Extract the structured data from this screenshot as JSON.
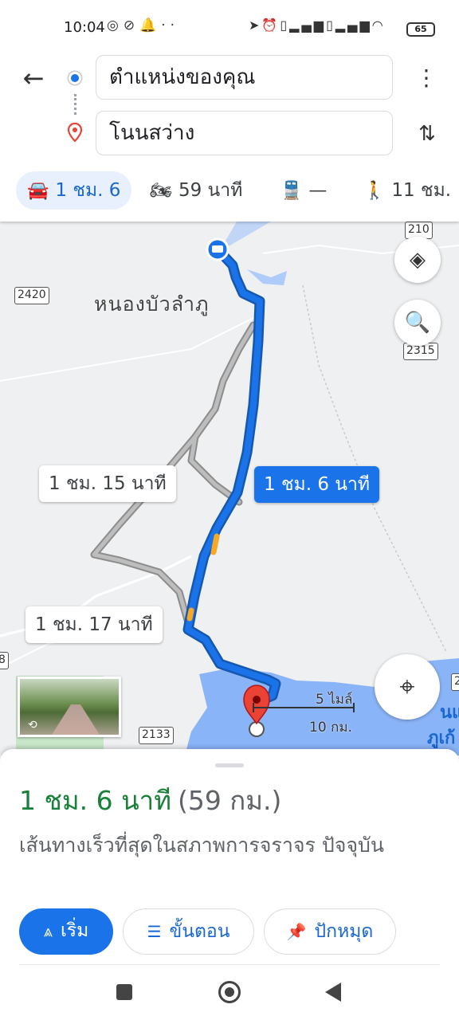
{
  "status_bar": {
    "time": "10:04",
    "left_icons": [
      "chrome-icon",
      "messenger-icon",
      "notification-bell-icon",
      "more-dots-icon"
    ],
    "right_icons": [
      "location-arrow-icon",
      "alarm-icon",
      "volte-icon",
      "signal-icon",
      "volte-icon",
      "signal-icon",
      "wifi-icon"
    ],
    "battery": "65"
  },
  "search": {
    "origin": "ตำแหน่งของคุณ",
    "destination": "โนนสว่าง"
  },
  "modes": {
    "drive": "1 ชม. 6",
    "motorcycle": "59 นาที",
    "transit": "—",
    "walk": "11 ชม."
  },
  "map": {
    "town_label": "หนองบัวลำภู",
    "road_shields": {
      "r210": "210",
      "r2420": "2420",
      "r2315": "2315",
      "r2133": "2133",
      "edge_left": "8",
      "edge_right": "2"
    },
    "route_chips": {
      "alt1": "1 ชม. 15 นาที",
      "main": "1 ชม. 6 นาที",
      "alt2": "1 ชม. 17 นาที"
    },
    "scale": {
      "miles": "5 ไมล์",
      "km": "10 กม."
    },
    "edge_label_1": "นแ",
    "edge_label_2": "ภูเก้"
  },
  "sheet": {
    "duration": "1 ชม. 6 นาที",
    "distance": "(59 กม.)",
    "description": "เส้นทางเร็วที่สุดในสภาพการจราจร ปัจจุบัน",
    "actions": {
      "start": "เริ่ม",
      "steps": "ขั้นตอน",
      "pin": "ปักหมุด"
    }
  },
  "colors": {
    "accent": "#1a73e8",
    "route_main": "#1a73e8",
    "route_alt": "#9e9e9e",
    "duration_green": "#188038",
    "water": "#8ab4f8",
    "pin_red": "#ea4335"
  }
}
